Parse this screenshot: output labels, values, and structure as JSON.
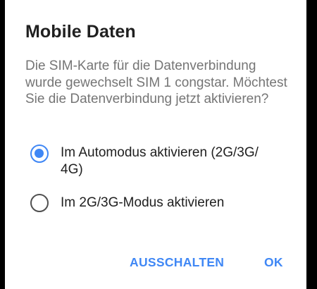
{
  "dialog": {
    "title": "Mobile Daten",
    "message": "Die SIM-Karte für die Datenverbindung wurde gewechselt SIM 1 congstar. Möchtest Sie die Datenverbindung jetzt aktivieren?",
    "options": [
      {
        "label": "Im Automodus aktivieren (2G/3G/ 4G)",
        "selected": true
      },
      {
        "label": "Im 2G/3G-Modus aktivieren",
        "selected": false
      }
    ],
    "buttons": {
      "negative": "AUSSCHALTEN",
      "positive": "OK"
    }
  },
  "colors": {
    "accent": "#3f87f5",
    "title_text": "#202020",
    "body_text": "#757575",
    "background": "#ffffff",
    "scrim": "#000000"
  }
}
